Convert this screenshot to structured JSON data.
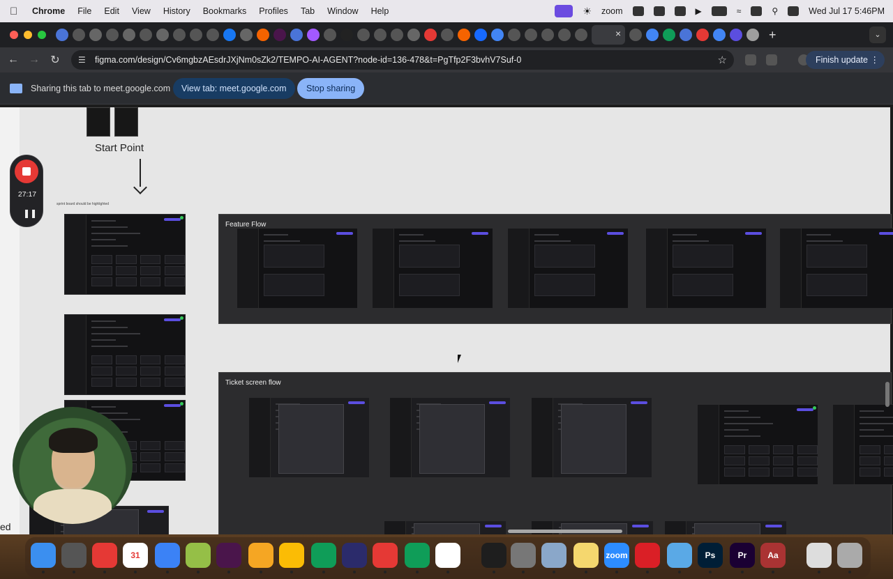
{
  "menubar": {
    "app": "Chrome",
    "menus": [
      "File",
      "Edit",
      "View",
      "History",
      "Bookmarks",
      "Profiles",
      "Tab",
      "Window",
      "Help"
    ],
    "zoom_label": "zoom",
    "datetime": "Wed Jul 17  5:46PM"
  },
  "browser": {
    "url": "figma.com/design/Cv6mgbzAEsdrJXjNm0sZk2/TEMPO-AI-AGENT?node-id=136-478&t=PgTfp2F3bvhV7Suf-0",
    "finish_update": "Finish update"
  },
  "sharebar": {
    "text": "Sharing this tab to meet.google.com",
    "view_tab": "View tab: meet.google.com",
    "stop": "Stop sharing"
  },
  "canvas": {
    "start_label": "Start Point",
    "note": "sprint board should be highlighted",
    "feature_flow_title": "Feature Flow",
    "ticket_flow_title": "Ticket screen flow",
    "edge_text": "ed"
  },
  "recorder": {
    "time": "27:17"
  },
  "colors": {
    "canvas_bg": "#e6e6e6",
    "frame_bg": "#2c2c2e",
    "accent": "#5b4ee0",
    "record_red": "#e53935"
  },
  "dock": {
    "apps": [
      "Finder",
      "Preview",
      "Gmail",
      "Calendar",
      "Contacts",
      "Shopify",
      "Slack",
      "Craft",
      "Chrome",
      "Maps",
      "Sonic",
      "LifeBuoy",
      "Meet",
      "Freeform",
      "Figma",
      "System Settings",
      "Preview Screen",
      "Notes",
      "Zoom",
      "Creative Cloud",
      "QuickTime",
      "Photoshop",
      "Premiere",
      "Dictionary",
      "Document",
      "Trash"
    ],
    "labels": {
      "zoom": "zoom",
      "photoshop": "Ps",
      "premiere": "Pr",
      "dictionary": "Aa",
      "calendar": "31"
    }
  }
}
